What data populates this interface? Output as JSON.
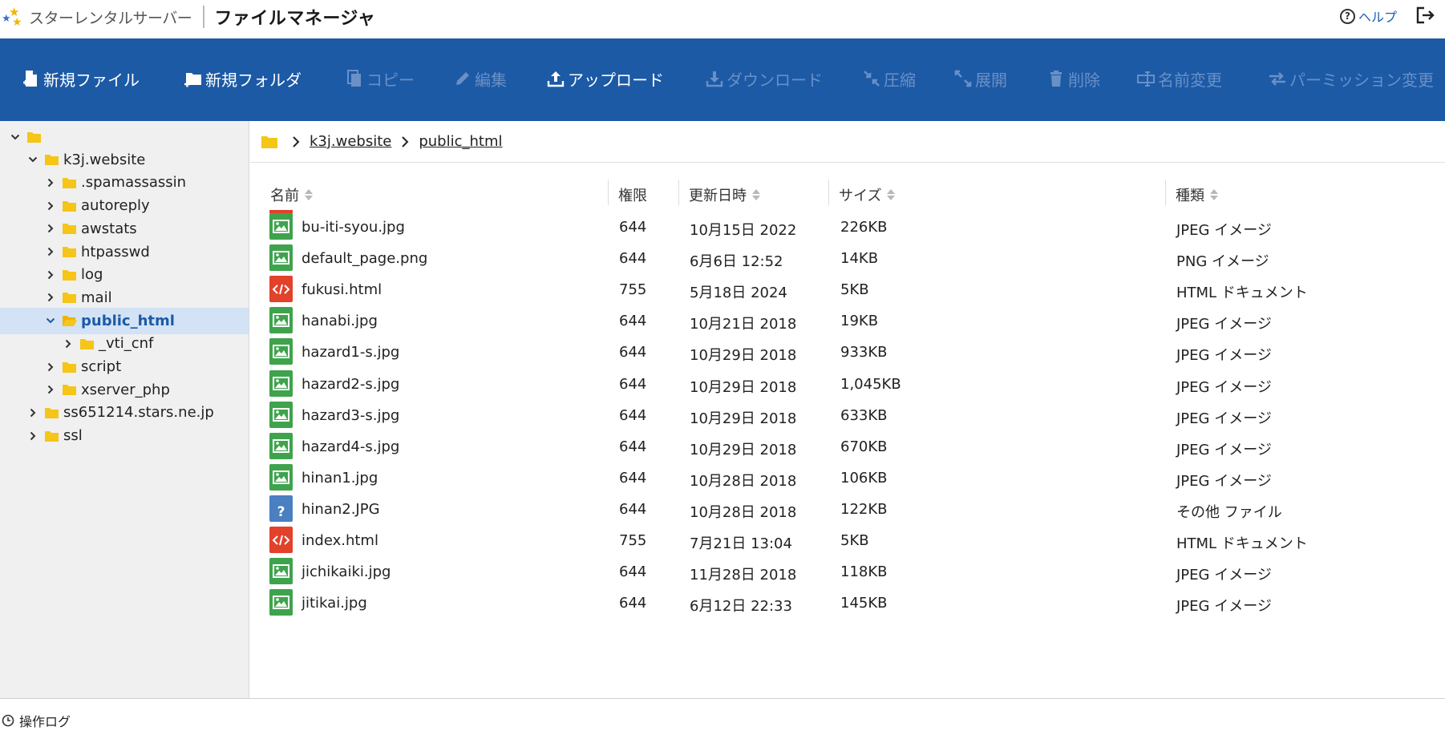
{
  "brand": {
    "name": "スターレンタルサーバー",
    "app_title": "ファイルマネージャ"
  },
  "header": {
    "help_label": "ヘルプ"
  },
  "toolbar": {
    "new_file": "新規ファイル",
    "new_folder": "新規フォルダ",
    "copy": "コピー",
    "edit": "編集",
    "upload": "アップロード",
    "download": "ダウンロード",
    "compress": "圧縮",
    "extract": "展開",
    "delete": "削除",
    "rename": "名前変更",
    "permission": "パーミッション変更"
  },
  "tree": [
    {
      "label": "",
      "level": 0,
      "expanded": true,
      "selected": false
    },
    {
      "label": "k3j.website",
      "level": 1,
      "expanded": true,
      "selected": false
    },
    {
      "label": ".spamassassin",
      "level": 2,
      "expanded": false,
      "selected": false
    },
    {
      "label": "autoreply",
      "level": 2,
      "expanded": false,
      "selected": false
    },
    {
      "label": "awstats",
      "level": 2,
      "expanded": false,
      "selected": false
    },
    {
      "label": "htpasswd",
      "level": 2,
      "expanded": false,
      "selected": false
    },
    {
      "label": "log",
      "level": 2,
      "expanded": false,
      "selected": false
    },
    {
      "label": "mail",
      "level": 2,
      "expanded": false,
      "selected": false
    },
    {
      "label": "public_html",
      "level": 2,
      "expanded": true,
      "selected": true
    },
    {
      "label": "_vti_cnf",
      "level": 3,
      "expanded": false,
      "selected": false
    },
    {
      "label": "script",
      "level": 2,
      "expanded": false,
      "selected": false
    },
    {
      "label": "xserver_php",
      "level": 2,
      "expanded": false,
      "selected": false
    },
    {
      "label": "ss651214.stars.ne.jp",
      "level": 1,
      "expanded": false,
      "selected": false
    },
    {
      "label": "ssl",
      "level": 1,
      "expanded": false,
      "selected": false
    }
  ],
  "breadcrumb": [
    "k3j.website",
    "public_html"
  ],
  "columns": {
    "name": "名前",
    "permission": "権限",
    "modified": "更新日時",
    "size": "サイズ",
    "type": "種類"
  },
  "files": [
    {
      "icon": "image-file-icon",
      "name": "bu-iti-syou.jpg",
      "permission": "644",
      "modified": "10月15日 2022",
      "size": "226KB",
      "type": "JPEG イメージ"
    },
    {
      "icon": "image-file-icon",
      "name": "default_page.png",
      "permission": "644",
      "modified": "6月6日 12:52",
      "size": "14KB",
      "type": "PNG イメージ"
    },
    {
      "icon": "html-file-icon",
      "name": "fukusi.html",
      "permission": "755",
      "modified": "5月18日 2024",
      "size": "5KB",
      "type": "HTML ドキュメント"
    },
    {
      "icon": "image-file-icon",
      "name": "hanabi.jpg",
      "permission": "644",
      "modified": "10月21日 2018",
      "size": "19KB",
      "type": "JPEG イメージ"
    },
    {
      "icon": "image-file-icon",
      "name": "hazard1-s.jpg",
      "permission": "644",
      "modified": "10月29日 2018",
      "size": "933KB",
      "type": "JPEG イメージ"
    },
    {
      "icon": "image-file-icon",
      "name": "hazard2-s.jpg",
      "permission": "644",
      "modified": "10月29日 2018",
      "size": "1,045KB",
      "type": "JPEG イメージ"
    },
    {
      "icon": "image-file-icon",
      "name": "hazard3-s.jpg",
      "permission": "644",
      "modified": "10月29日 2018",
      "size": "633KB",
      "type": "JPEG イメージ"
    },
    {
      "icon": "image-file-icon",
      "name": "hazard4-s.jpg",
      "permission": "644",
      "modified": "10月29日 2018",
      "size": "670KB",
      "type": "JPEG イメージ"
    },
    {
      "icon": "image-file-icon",
      "name": "hinan1.jpg",
      "permission": "644",
      "modified": "10月28日 2018",
      "size": "106KB",
      "type": "JPEG イメージ"
    },
    {
      "icon": "unknown-file-icon",
      "name": "hinan2.JPG",
      "permission": "644",
      "modified": "10月28日 2018",
      "size": "122KB",
      "type": "その他 ファイル"
    },
    {
      "icon": "html-file-icon",
      "name": "index.html",
      "permission": "755",
      "modified": "7月21日 13:04",
      "size": "5KB",
      "type": "HTML ドキュメント"
    },
    {
      "icon": "image-file-icon",
      "name": "jichikaiki.jpg",
      "permission": "644",
      "modified": "11月28日 2018",
      "size": "118KB",
      "type": "JPEG イメージ"
    },
    {
      "icon": "image-file-icon",
      "name": "jitikai.jpg",
      "permission": "644",
      "modified": "6月12日 22:33",
      "size": "145KB",
      "type": "JPEG イメージ"
    }
  ],
  "footer": {
    "oplog_label": "操作ログ"
  },
  "colors": {
    "toolbar_bg": "#1c5aa6",
    "selected_bg": "#d3e3f5",
    "folder": "#f5c518",
    "image_icon": "#3fa34d",
    "html_icon": "#e2412a",
    "unknown_icon": "#4a7fc1"
  }
}
